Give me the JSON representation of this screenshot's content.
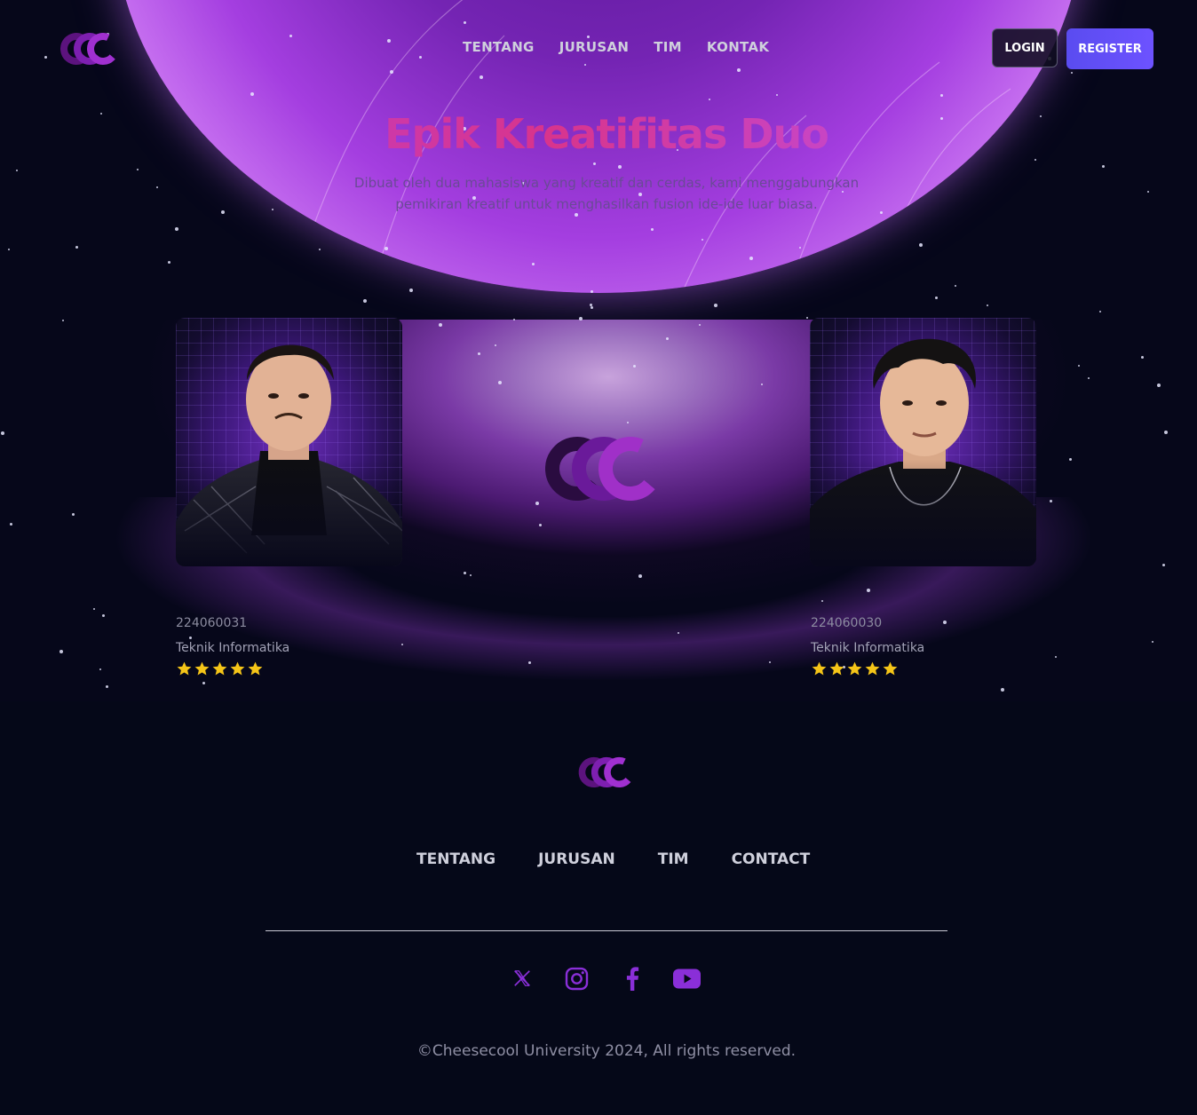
{
  "header": {
    "logo_icon": "cc-logo-icon",
    "nav": [
      "TENTANG",
      "JURUSAN",
      "TIM",
      "KONTAK"
    ],
    "login_label": "LOGIN",
    "register_label": "REGISTER"
  },
  "hero": {
    "title": "Epik Kreatifitas Duo",
    "subtitle": "Dibuat oleh dua mahasiswa yang kreatif dan cerdas, kami menggabungkan pemikiran kreatif untuk menghasilkan fusion ide-ide luar biasa."
  },
  "team": [
    {
      "nim": "224060031",
      "major": "Teknik Informatika",
      "rating": 5,
      "photo": "team-member-photo"
    },
    {
      "nim": "224060030",
      "major": "Teknik Informatika",
      "rating": 5,
      "photo": "team-member-photo"
    }
  ],
  "footer": {
    "nav": [
      "TENTANG",
      "JURUSAN",
      "TIM",
      "CONTACT"
    ],
    "socials": [
      "x-icon",
      "instagram-icon",
      "facebook-icon",
      "youtube-icon"
    ],
    "copyright": "©Cheesecool University 2024, All rights reserved."
  },
  "colors": {
    "background": "#06071a",
    "accent_purple": "#9a2fd8",
    "register_button": "#5a4cf0",
    "star": "#f5c518"
  }
}
